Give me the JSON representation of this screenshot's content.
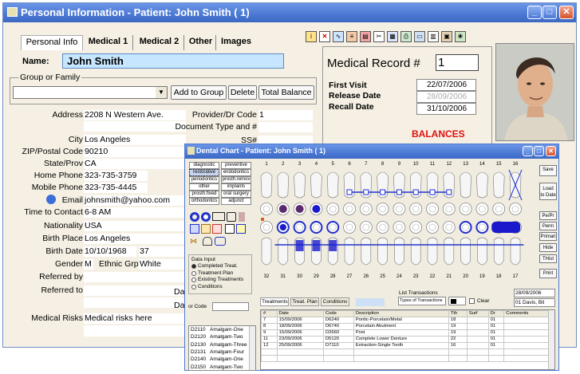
{
  "main_window": {
    "title": "Personal Information - Patient: John Smith ( 1)",
    "tabs": [
      "Personal Info",
      "Medical 1",
      "Medical 2",
      "Other",
      "Images"
    ],
    "name_label": "Name:",
    "name_value": "John Smith",
    "group_label": "Group or Family",
    "add_to_group": "Add to Group",
    "delete": "Delete",
    "total_balance": "Total Balance",
    "medical_record_label": "Medical Record #",
    "medical_record_value": "1",
    "first_visit_label": "First Visit",
    "first_visit_value": "22/07/2006",
    "release_date_label": "Release Date",
    "release_date_value": "28/09/2006",
    "recall_date_label": "Recall Date",
    "recall_date_value": "31/10/2006",
    "balances_label": "BALANCES",
    "fields": {
      "address_label": "Address",
      "address_value": "2208 N Western Ave.",
      "city_label": "City",
      "city_value": "Los Angeles",
      "zip_label": "ZIP/Postal Code",
      "zip_value": "90210",
      "state_label": "State/Prov",
      "state_value": "CA",
      "home_phone_label": "Home Phone",
      "home_phone_value": "323-735-3759",
      "mobile_phone_label": "Mobile Phone",
      "mobile_phone_value": "323-735-4445",
      "email_label": "Email",
      "email_value": "johnsmith@yahoo.com",
      "time_to_contact_label": "Time to Contact",
      "time_to_contact_value": "6-8 AM",
      "nationality_label": "Nationality",
      "nationality_value": "USA",
      "birth_place_label": "Birth Place",
      "birth_place_value": "Los Angeles",
      "birth_date_label": "Birth Date",
      "birth_date_value": "10/10/1968",
      "age_value": "37",
      "gender_label": "Gender",
      "gender_value": "M",
      "ethnic_label": "Ethnic Grp",
      "ethnic_value": "White",
      "referred_by_label": "Referred by",
      "referred_to_label": "Referred to",
      "medical_risks_label": "Medical Risks",
      "medical_risks_value": "Medical risks here",
      "provider_label": "Provider/Dr Code",
      "provider_value": "1",
      "doc_type_label": "Document Type and #",
      "ss_label": "SS#",
      "dat1_label": "Dat",
      "dat2_label": "Dat"
    }
  },
  "dental_chart": {
    "title": "Dental Chart - Patient: John Smith ( 1)",
    "categories": [
      "diagnostic",
      "preventive",
      "restorative",
      "endodontics",
      "periodontics",
      "prosth.remov",
      "other",
      "implants",
      "prosth.fixed",
      "oral surgery",
      "orthodontics",
      "adjunct"
    ],
    "upper_numbers": [
      "1",
      "2",
      "3",
      "4",
      "5",
      "6",
      "7",
      "8",
      "9",
      "10",
      "11",
      "12",
      "13",
      "14",
      "15",
      "16"
    ],
    "lower_numbers": [
      "32",
      "31",
      "30",
      "29",
      "28",
      "27",
      "26",
      "25",
      "24",
      "23",
      "22",
      "21",
      "20",
      "19",
      "18",
      "17"
    ],
    "side_buttons": [
      "Save",
      "Load to Date",
      "Pe/Pr",
      "Perm",
      "Primari",
      "Hide",
      "THist",
      "Print"
    ],
    "data_input_label": "Data Input",
    "data_input_options": [
      "Completed Treat.",
      "Treatment Plan",
      "Existing Treatments",
      "Conditions"
    ],
    "or_code_label": "or Code",
    "codes": [
      {
        "code": "D2110",
        "name": "Amalgam-One"
      },
      {
        "code": "D2120",
        "name": "Amalgam-Two"
      },
      {
        "code": "D2130",
        "name": "Amalgam-Three"
      },
      {
        "code": "D2131",
        "name": "Amalgam-Four"
      },
      {
        "code": "D2140",
        "name": "Amalgam-One"
      },
      {
        "code": "D2150",
        "name": "Amalgam-Two"
      }
    ],
    "tabs": [
      "Treatments",
      "Treat. Plan",
      "Conditions"
    ],
    "list_transactions_label": "List Transactions",
    "list_transactions_value": "Types of Transactions",
    "clear_label": "Clear",
    "date_value": "28/09/2006",
    "doctor_value": "01 Davis, Bil",
    "columns": [
      "#",
      "Date",
      "Code",
      "Description",
      "Tth",
      "Surf",
      "Dr",
      "Comments"
    ],
    "rows": [
      [
        "7",
        "15/09/2006",
        "D6240",
        "Pontic-Porcelain/Metal",
        "18",
        "",
        "01",
        ""
      ],
      [
        "8",
        "18/09/2006",
        "D6740",
        "Porcelain Abutment",
        "19",
        "",
        "01",
        ""
      ],
      [
        "9",
        "15/09/2006",
        "D2660",
        "Post",
        "19",
        "",
        "01",
        ""
      ],
      [
        "11",
        "23/09/2006",
        "D5120",
        "Complete Lower Denture",
        "22",
        "",
        "01",
        ""
      ],
      [
        "12",
        "25/09/2006",
        "D7110",
        "Extraction-Single Tooth",
        "16",
        "",
        "01",
        ""
      ]
    ]
  }
}
